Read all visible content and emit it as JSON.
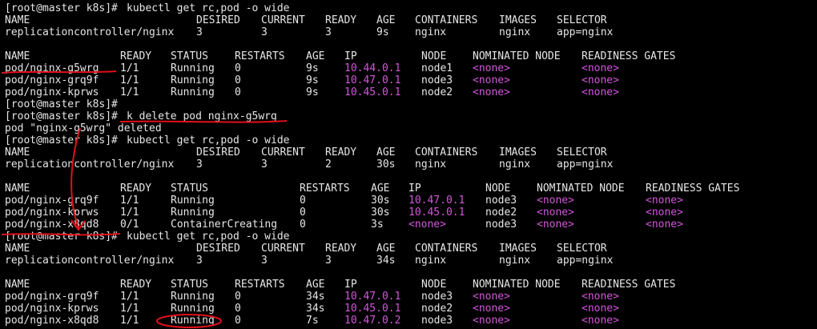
{
  "theme": {
    "background": "#000000",
    "text": "#e6e6e6",
    "ip_color": "#d157d9",
    "none_color": "#d157d9",
    "annotation_color": "#e0101a"
  },
  "lines": [
    {
      "kind": "prompt",
      "prompt": "[root@master k8s]#",
      "command": "kubectl get rc,pod -o wide"
    },
    {
      "kind": "rc_header",
      "cells": [
        "NAME",
        "DESIRED",
        "CURRENT",
        "READY",
        "AGE",
        "CONTAINERS",
        "IMAGES",
        "SELECTOR"
      ]
    },
    {
      "kind": "rc_row",
      "cells": [
        "replicationcontroller/nginx",
        "3",
        "3",
        "3",
        "9s",
        "nginx",
        "nginx",
        "app=nginx"
      ]
    },
    {
      "kind": "blank"
    },
    {
      "kind": "pod_header_a",
      "cells": [
        "NAME",
        "READY",
        "STATUS",
        "RESTARTS",
        "AGE",
        "IP",
        "NODE",
        "NOMINATED NODE",
        "READINESS GATES"
      ]
    },
    {
      "kind": "pod_row_a",
      "cells": [
        "pod/nginx-g5wrg",
        "1/1",
        "Running",
        "0",
        "9s",
        "10.44.0.1",
        "node1",
        "<none>",
        "<none>"
      ]
    },
    {
      "kind": "pod_row_a",
      "cells": [
        "pod/nginx-grq9f",
        "1/1",
        "Running",
        "0",
        "9s",
        "10.47.0.1",
        "node3",
        "<none>",
        "<none>"
      ]
    },
    {
      "kind": "pod_row_a",
      "cells": [
        "pod/nginx-kprws",
        "1/1",
        "Running",
        "0",
        "9s",
        "10.45.0.1",
        "node2",
        "<none>",
        "<none>"
      ]
    },
    {
      "kind": "prompt",
      "prompt": "[root@master k8s]#",
      "command": ""
    },
    {
      "kind": "prompt",
      "prompt": "[root@master k8s]#",
      "command": "k delete pod nginx-g5wrg"
    },
    {
      "kind": "plain",
      "text": "pod \"nginx-g5wrg\" deleted"
    },
    {
      "kind": "prompt",
      "prompt": "[root@master k8s]#",
      "command": "kubectl get rc,pod -o wide"
    },
    {
      "kind": "rc_header",
      "cells": [
        "NAME",
        "DESIRED",
        "CURRENT",
        "READY",
        "AGE",
        "CONTAINERS",
        "IMAGES",
        "SELECTOR"
      ]
    },
    {
      "kind": "rc_row",
      "cells": [
        "replicationcontroller/nginx",
        "3",
        "3",
        "2",
        "30s",
        "nginx",
        "nginx",
        "app=nginx"
      ]
    },
    {
      "kind": "blank"
    },
    {
      "kind": "pod_header_b",
      "cells": [
        "NAME",
        "READY",
        "STATUS",
        "RESTARTS",
        "AGE",
        "IP",
        "NODE",
        "NOMINATED NODE",
        "READINESS GATES"
      ]
    },
    {
      "kind": "pod_row_b",
      "cells": [
        "pod/nginx-grq9f",
        "1/1",
        "Running",
        "0",
        "30s",
        "10.47.0.1",
        "node3",
        "<none>",
        "<none>"
      ]
    },
    {
      "kind": "pod_row_b",
      "cells": [
        "pod/nginx-kprws",
        "1/1",
        "Running",
        "0",
        "30s",
        "10.45.0.1",
        "node2",
        "<none>",
        "<none>"
      ]
    },
    {
      "kind": "pod_row_b",
      "cells": [
        "pod/nginx-x8qd8",
        "0/1",
        "ContainerCreating",
        "0",
        "3s",
        "<none>",
        "node3",
        "<none>",
        "<none>"
      ]
    },
    {
      "kind": "prompt",
      "prompt": "[root@master k8s]#",
      "command": "kubectl get rc,pod -o wide"
    },
    {
      "kind": "rc_header",
      "cells": [
        "NAME",
        "DESIRED",
        "CURRENT",
        "READY",
        "AGE",
        "CONTAINERS",
        "IMAGES",
        "SELECTOR"
      ]
    },
    {
      "kind": "rc_row",
      "cells": [
        "replicationcontroller/nginx",
        "3",
        "3",
        "3",
        "34s",
        "nginx",
        "nginx",
        "app=nginx"
      ]
    },
    {
      "kind": "blank"
    },
    {
      "kind": "pod_header_a",
      "cells": [
        "NAME",
        "READY",
        "STATUS",
        "RESTARTS",
        "AGE",
        "IP",
        "NODE",
        "NOMINATED NODE",
        "READINESS GATES"
      ]
    },
    {
      "kind": "pod_row_a",
      "cells": [
        "pod/nginx-grq9f",
        "1/1",
        "Running",
        "0",
        "34s",
        "10.47.0.1",
        "node3",
        "<none>",
        "<none>"
      ]
    },
    {
      "kind": "pod_row_a",
      "cells": [
        "pod/nginx-kprws",
        "1/1",
        "Running",
        "0",
        "34s",
        "10.45.0.1",
        "node2",
        "<none>",
        "<none>"
      ]
    },
    {
      "kind": "pod_row_a",
      "cells": [
        "pod/nginx-x8qd8",
        "1/1",
        "Running",
        "0",
        "7s",
        "10.47.0.2",
        "node3",
        "<none>",
        "<none>"
      ]
    }
  ]
}
